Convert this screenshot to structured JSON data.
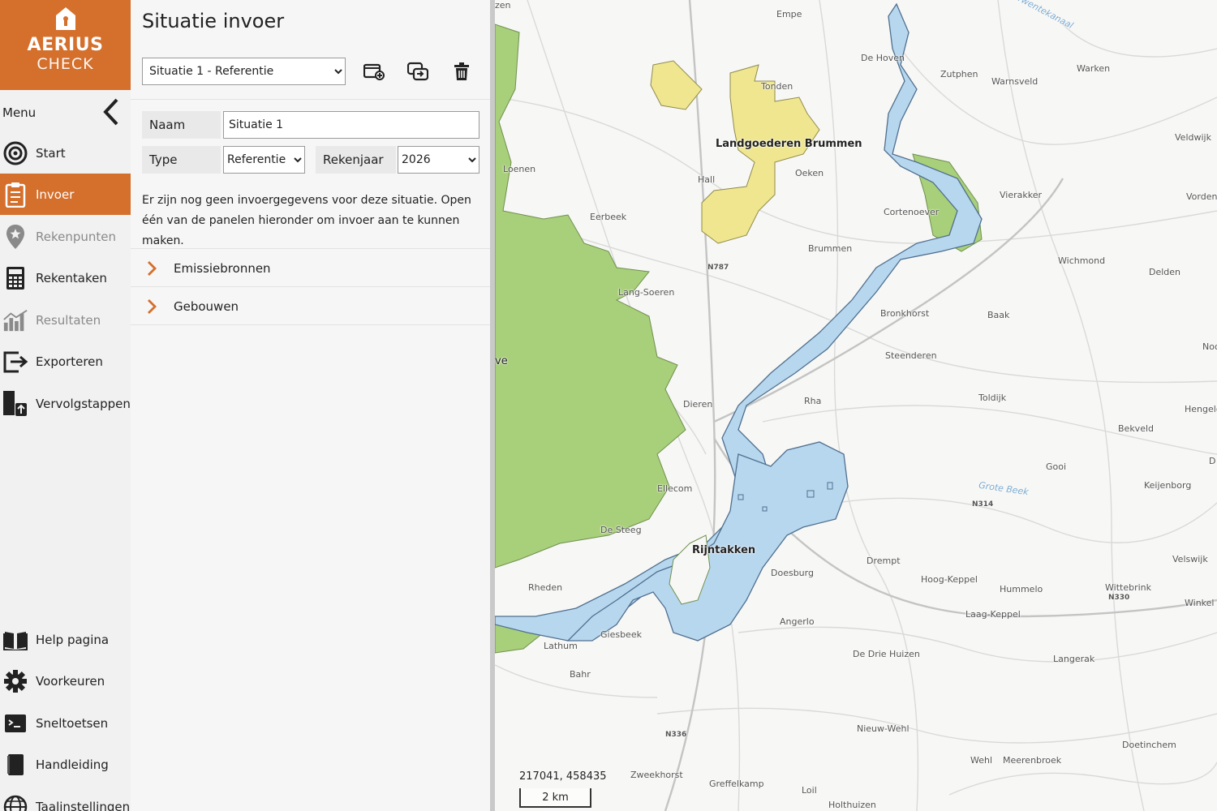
{
  "app": {
    "logo_title": "AERIUS",
    "logo_subtitle": "CHECK",
    "brand_color": "#d46f2c"
  },
  "sidebar": {
    "menu_label": "Menu",
    "items": [
      {
        "label": "Start",
        "icon": "target-icon",
        "state": "normal"
      },
      {
        "label": "Invoer",
        "icon": "clipboard-icon",
        "state": "active"
      },
      {
        "label": "Rekenpunten",
        "icon": "map-pin-icon",
        "state": "disabled"
      },
      {
        "label": "Rekentaken",
        "icon": "calculator-icon",
        "state": "normal"
      },
      {
        "label": "Resultaten",
        "icon": "chart-icon",
        "state": "disabled"
      },
      {
        "label": "Exporteren",
        "icon": "export-icon",
        "state": "normal"
      },
      {
        "label": "Vervolgstappen",
        "icon": "next-steps-icon",
        "state": "normal"
      }
    ],
    "bottom_items": [
      {
        "label": "Help pagina",
        "icon": "book-icon"
      },
      {
        "label": "Voorkeuren",
        "icon": "gear-icon"
      },
      {
        "label": "Sneltoetsen",
        "icon": "keyboard-icon"
      },
      {
        "label": "Handleiding",
        "icon": "manual-icon"
      },
      {
        "label": "Taalinstellingen",
        "icon": "globe-icon"
      }
    ]
  },
  "panel": {
    "title": "Situatie invoer",
    "scenario_select": "Situatie 1 - Referentie",
    "fields": {
      "name_label": "Naam",
      "name_value": "Situatie 1",
      "type_label": "Type",
      "type_value": "Referentie",
      "year_label": "Rekenjaar",
      "year_value": "2026"
    },
    "info_text": "Er zijn nog geen invoergegevens voor deze situatie. Open één van de panelen hieronder om invoer aan te kunnen maken.",
    "accordions": [
      {
        "label": "Emissiebronnen"
      },
      {
        "label": "Gebouwen"
      }
    ]
  },
  "map": {
    "coordinates": "217041, 458435",
    "scale_label": "2 km",
    "areas": [
      "Landgoederen Brummen",
      "Rijntakken"
    ],
    "places": [
      "Empe",
      "De Hoven",
      "Zutphen",
      "Warnsveld",
      "Warken",
      "Tonden",
      "Loenen",
      "Hall",
      "Oeken",
      "Veldwijk",
      "Vierakker",
      "Vorden",
      "Eerbeek",
      "Cortenoever",
      "Brummen",
      "Wichmond",
      "Delden",
      "Lang-Soeren",
      "Bronkhorst",
      "Baak",
      "Steenderen",
      "Dieren",
      "Rha",
      "Toldijk",
      "Hengelo",
      "Bekveld",
      "Gooi",
      "Keijenborg",
      "Ellecom",
      "De Steeg",
      "Velswijk",
      "Drempt",
      "Doesburg",
      "Hoog-Keppel",
      "Hummelo",
      "Wittebrink",
      "Rheden",
      "Angerlo",
      "Laag-Keppel",
      "Giesbeek",
      "Lathum",
      "De Drie Huizen",
      "Langerak",
      "Bahr",
      "Nieuw-Wehl",
      "Doetinchem",
      "Wehl",
      "Meerenbroek",
      "Zweekhorst",
      "Greffelkamp",
      "Loil",
      "Holthuizen",
      "Winkel",
      "Noo",
      "D",
      "ve",
      "zen"
    ],
    "roads": [
      "N787",
      "N314",
      "N330",
      "N336"
    ],
    "waters": [
      "Grote Beek",
      "Twentekanaal"
    ],
    "colors": {
      "water": "#b7d7ef",
      "water_edge": "#4f6f8f",
      "forest": "#a8cf7a",
      "estate": "#efe68f",
      "background": "#f7f7f5"
    }
  }
}
